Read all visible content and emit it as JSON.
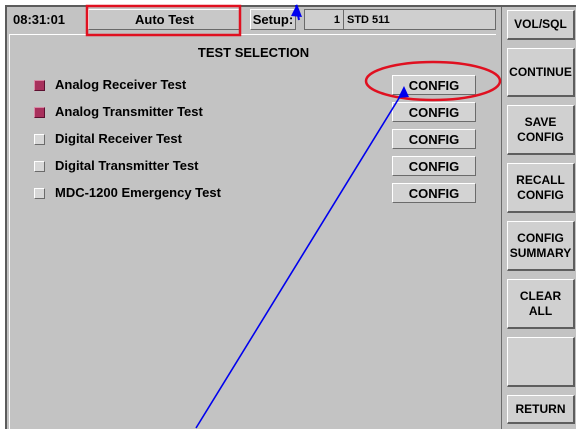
{
  "status_bar": {
    "time": "08:31:01",
    "mode": "Auto Test",
    "setup_label": "Setup:",
    "setup_number": "1",
    "setup_name": "STD 511"
  },
  "panel": {
    "title": "TEST SELECTION",
    "config_label": "CONFIG",
    "tests": [
      {
        "label": "Analog Receiver Test",
        "checked": true
      },
      {
        "label": "Analog Transmitter Test",
        "checked": true
      },
      {
        "label": "Digital Receiver Test",
        "checked": false
      },
      {
        "label": "Digital Transmitter Test",
        "checked": false
      },
      {
        "label": "MDC-1200 Emergency Test",
        "checked": false
      }
    ]
  },
  "softkeys": {
    "vol_sql": "VOL/SQL",
    "continue": "CONTINUE",
    "save_config": "SAVE\nCONFIG",
    "recall_config": "RECALL\nCONFIG",
    "config_summary": "CONFIG\nSUMMARY",
    "clear_all": "CLEAR\nALL",
    "blank": "",
    "return": "RETURN"
  },
  "colors": {
    "background": "#c3c3c3",
    "checked_box": "#a8305c",
    "highlight_red": "#e01020",
    "annotation_blue": "#0000ee"
  }
}
